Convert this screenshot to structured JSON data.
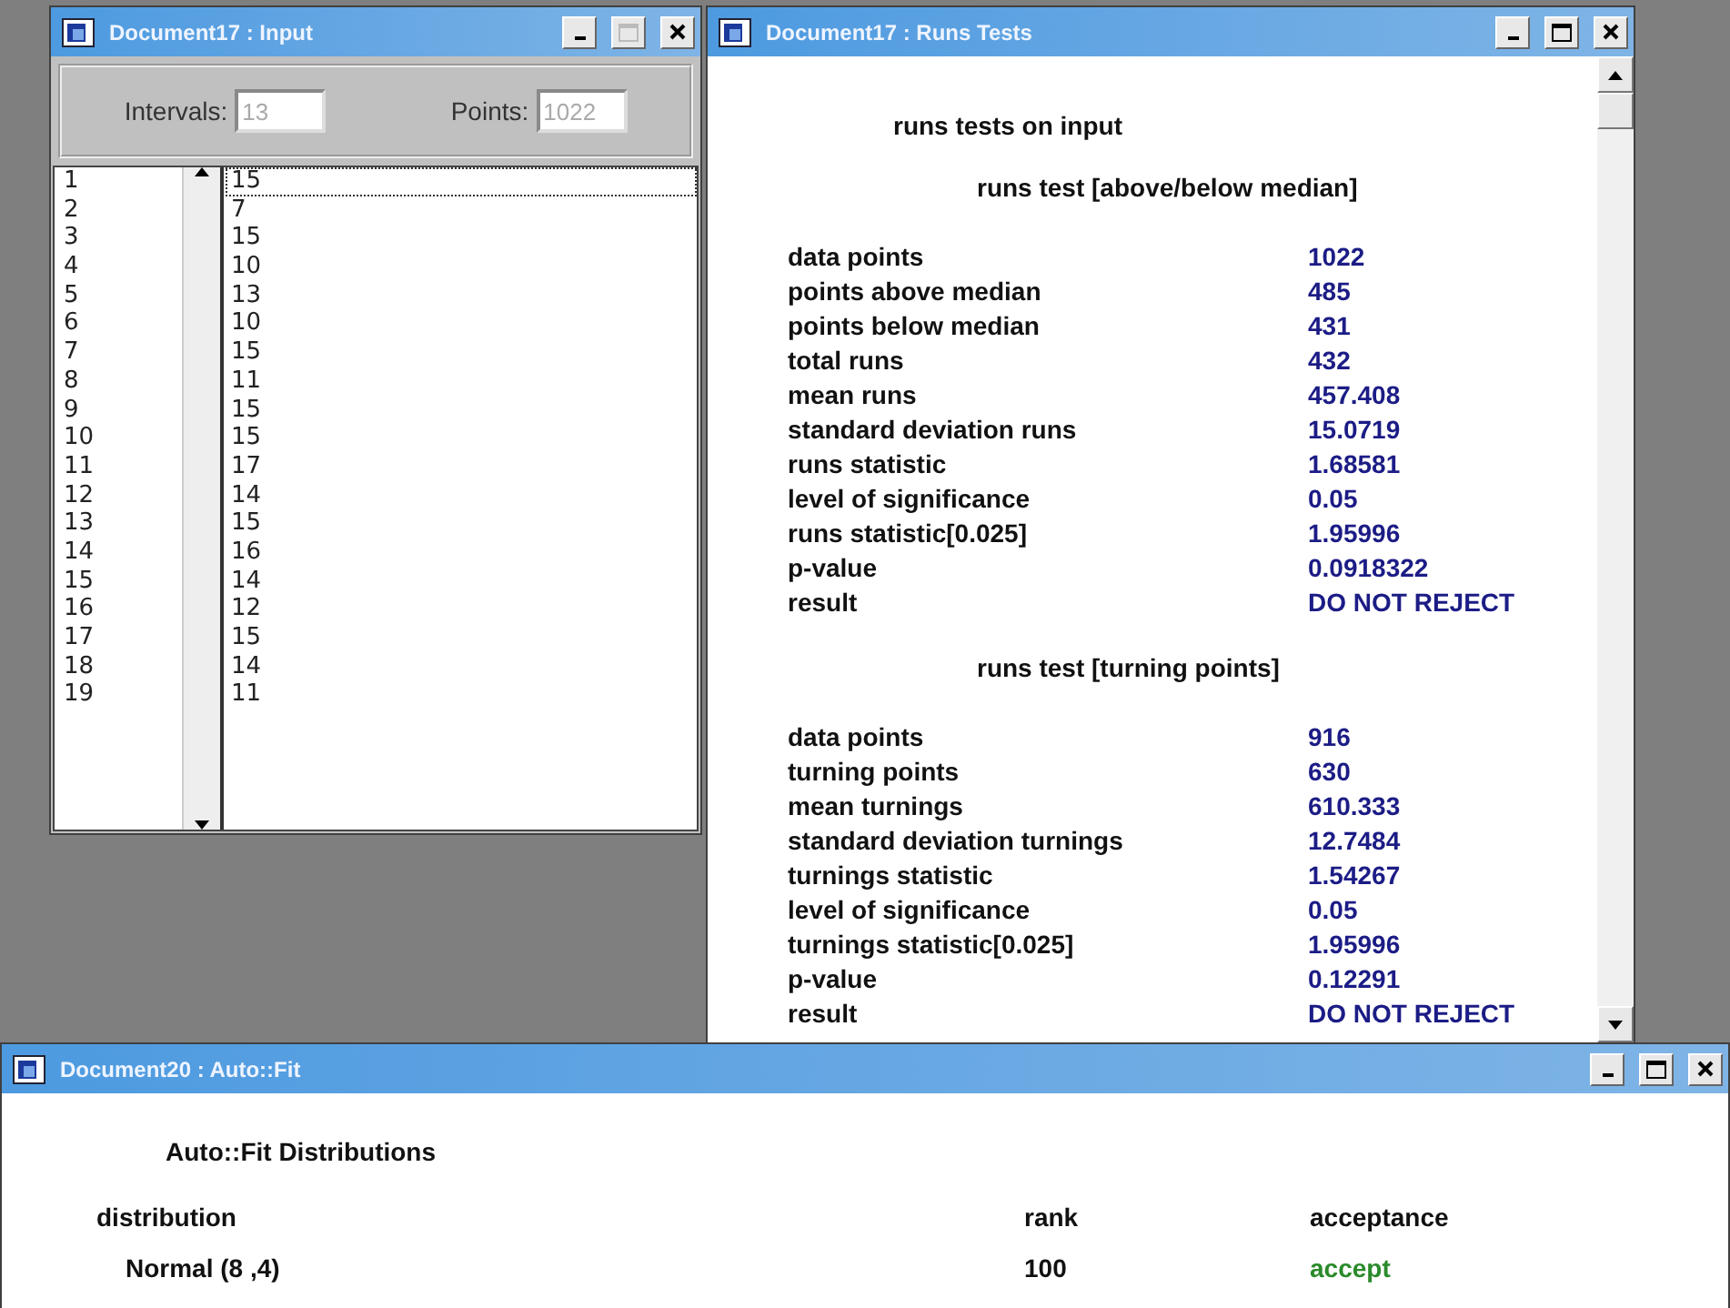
{
  "input_window": {
    "title": "Document17 : Input",
    "intervals": {
      "label": "Intervals:",
      "value": "13",
      "disabled": true
    },
    "points": {
      "label": "Points:",
      "value": "1022",
      "disabled": true
    },
    "rows": [
      {
        "index": "1",
        "value": "15",
        "selected": true
      },
      {
        "index": "2",
        "value": "7",
        "selected": false
      },
      {
        "index": "3",
        "value": "15",
        "selected": false
      },
      {
        "index": "4",
        "value": "10",
        "selected": false
      },
      {
        "index": "5",
        "value": "13",
        "selected": false
      },
      {
        "index": "6",
        "value": "10",
        "selected": false
      },
      {
        "index": "7",
        "value": "15",
        "selected": false
      },
      {
        "index": "8",
        "value": "11",
        "selected": false
      },
      {
        "index": "9",
        "value": "15",
        "selected": false
      },
      {
        "index": "10",
        "value": "15",
        "selected": false
      },
      {
        "index": "11",
        "value": "17",
        "selected": false
      },
      {
        "index": "12",
        "value": "14",
        "selected": false
      },
      {
        "index": "13",
        "value": "15",
        "selected": false
      },
      {
        "index": "14",
        "value": "16",
        "selected": false
      },
      {
        "index": "15",
        "value": "14",
        "selected": false
      },
      {
        "index": "16",
        "value": "12",
        "selected": false
      },
      {
        "index": "17",
        "value": "15",
        "selected": false
      },
      {
        "index": "18",
        "value": "14",
        "selected": false
      },
      {
        "index": "19",
        "value": "11",
        "selected": false
      }
    ]
  },
  "runs_window": {
    "title": "Document17 : Runs Tests",
    "heading": "runs tests on input",
    "sections": [
      {
        "heading": "runs test [above/below median]",
        "rows": [
          {
            "label": "data points",
            "value": "1022"
          },
          {
            "label": "points above median",
            "value": "485"
          },
          {
            "label": "points below median",
            "value": "431"
          },
          {
            "label": "total runs",
            "value": "432"
          },
          {
            "label": "mean runs",
            "value": "457.408"
          },
          {
            "label": "standard deviation runs",
            "value": "15.0719"
          },
          {
            "label": "runs statistic",
            "value": "1.68581"
          },
          {
            "label": "level of significance",
            "value": "0.05"
          },
          {
            "label": "runs statistic[0.025]",
            "value": "1.95996"
          },
          {
            "label": "p-value",
            "value": "0.0918322"
          },
          {
            "label": "result",
            "value": "DO NOT REJECT"
          }
        ]
      },
      {
        "heading": "runs test [turning points]",
        "rows": [
          {
            "label": "data points",
            "value": "916"
          },
          {
            "label": "turning points",
            "value": "630"
          },
          {
            "label": "mean turnings",
            "value": "610.333"
          },
          {
            "label": "standard deviation turnings",
            "value": "12.7484"
          },
          {
            "label": "turnings statistic",
            "value": "1.54267"
          },
          {
            "label": "level of significance",
            "value": "0.05"
          },
          {
            "label": "turnings statistic[0.025]",
            "value": "1.95996"
          },
          {
            "label": "p-value",
            "value": "0.12291"
          },
          {
            "label": "result",
            "value": "DO NOT REJECT"
          }
        ]
      }
    ]
  },
  "autofit_window": {
    "title": "Document20 : Auto::Fit",
    "heading": "Auto::Fit Distributions",
    "columns": [
      "distribution",
      "rank",
      "acceptance"
    ],
    "rows": [
      {
        "distribution": "Normal (8 ,4)",
        "rank": "100",
        "acceptance": "accept",
        "accepted": true
      }
    ]
  }
}
